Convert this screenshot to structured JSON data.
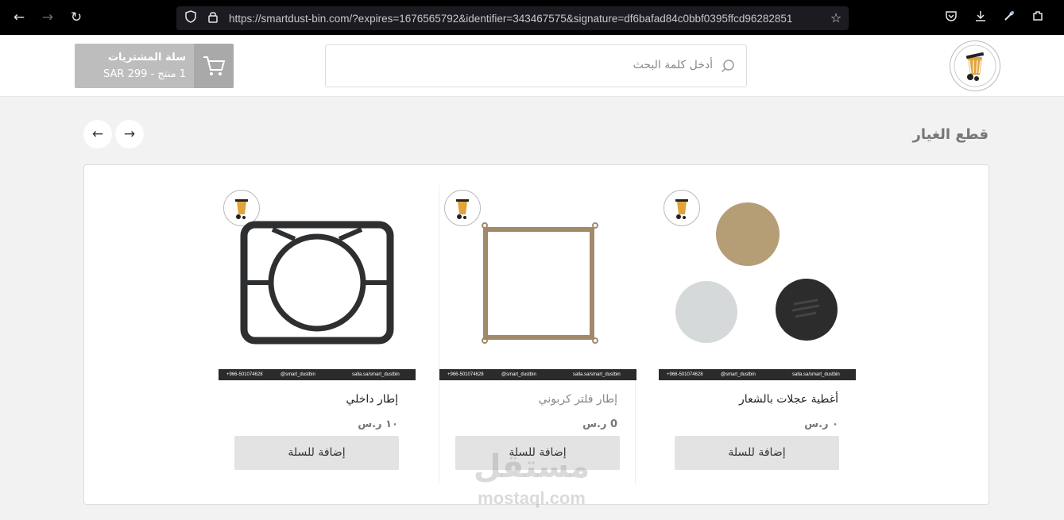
{
  "browser": {
    "url": "https://smartdust-bin.com/?expires=1676565792&identifier=343467575&signature=df6bafad84c0bbf0395ffcd96282851"
  },
  "header": {
    "search_placeholder": "أدخل كلمة البحث",
    "cart_title": "سلة المشتريات",
    "cart_summary": "1 منتج - SAR 299"
  },
  "section": {
    "title": "قطع الغيار"
  },
  "products": [
    {
      "name": "أغطية عجلات بالشعار",
      "price": "٠ ر.س",
      "add_label": "إضافة للسلة",
      "muted": false
    },
    {
      "name": "إطار فلتر كربوني",
      "price": "0 ر.س",
      "add_label": "إضافة للسلة",
      "muted": true
    },
    {
      "name": "إطار داخلي",
      "price": "١٠ ر.س",
      "add_label": "إضافة للسلة",
      "muted": false
    }
  ],
  "contact": {
    "phone": "+966-501074628",
    "instagram": "@smart_dustbin",
    "store": "salla.sa/smart_dustbin"
  },
  "watermark": {
    "logo": "مستقل",
    "text": "mostaql.com"
  },
  "colors": {
    "cart_bg": "#bdbdbd",
    "button_bg": "#e3e3e3",
    "logo_yellow": "#e0a43a"
  }
}
